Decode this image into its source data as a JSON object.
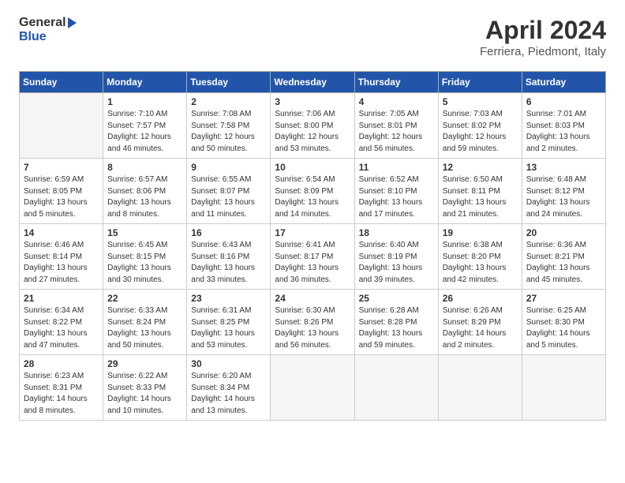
{
  "logo": {
    "general": "General",
    "blue": "Blue"
  },
  "title": "April 2024",
  "subtitle": "Ferriera, Piedmont, Italy",
  "days_of_week": [
    "Sunday",
    "Monday",
    "Tuesday",
    "Wednesday",
    "Thursday",
    "Friday",
    "Saturday"
  ],
  "weeks": [
    [
      {
        "day": "",
        "content": "",
        "empty": true
      },
      {
        "day": "1",
        "content": "Sunrise: 7:10 AM\nSunset: 7:57 PM\nDaylight: 12 hours\nand 46 minutes."
      },
      {
        "day": "2",
        "content": "Sunrise: 7:08 AM\nSunset: 7:58 PM\nDaylight: 12 hours\nand 50 minutes."
      },
      {
        "day": "3",
        "content": "Sunrise: 7:06 AM\nSunset: 8:00 PM\nDaylight: 12 hours\nand 53 minutes."
      },
      {
        "day": "4",
        "content": "Sunrise: 7:05 AM\nSunset: 8:01 PM\nDaylight: 12 hours\nand 56 minutes."
      },
      {
        "day": "5",
        "content": "Sunrise: 7:03 AM\nSunset: 8:02 PM\nDaylight: 12 hours\nand 59 minutes."
      },
      {
        "day": "6",
        "content": "Sunrise: 7:01 AM\nSunset: 8:03 PM\nDaylight: 13 hours\nand 2 minutes."
      }
    ],
    [
      {
        "day": "7",
        "content": "Sunrise: 6:59 AM\nSunset: 8:05 PM\nDaylight: 13 hours\nand 5 minutes."
      },
      {
        "day": "8",
        "content": "Sunrise: 6:57 AM\nSunset: 8:06 PM\nDaylight: 13 hours\nand 8 minutes."
      },
      {
        "day": "9",
        "content": "Sunrise: 6:55 AM\nSunset: 8:07 PM\nDaylight: 13 hours\nand 11 minutes."
      },
      {
        "day": "10",
        "content": "Sunrise: 6:54 AM\nSunset: 8:09 PM\nDaylight: 13 hours\nand 14 minutes."
      },
      {
        "day": "11",
        "content": "Sunrise: 6:52 AM\nSunset: 8:10 PM\nDaylight: 13 hours\nand 17 minutes."
      },
      {
        "day": "12",
        "content": "Sunrise: 6:50 AM\nSunset: 8:11 PM\nDaylight: 13 hours\nand 21 minutes."
      },
      {
        "day": "13",
        "content": "Sunrise: 6:48 AM\nSunset: 8:12 PM\nDaylight: 13 hours\nand 24 minutes."
      }
    ],
    [
      {
        "day": "14",
        "content": "Sunrise: 6:46 AM\nSunset: 8:14 PM\nDaylight: 13 hours\nand 27 minutes."
      },
      {
        "day": "15",
        "content": "Sunrise: 6:45 AM\nSunset: 8:15 PM\nDaylight: 13 hours\nand 30 minutes."
      },
      {
        "day": "16",
        "content": "Sunrise: 6:43 AM\nSunset: 8:16 PM\nDaylight: 13 hours\nand 33 minutes."
      },
      {
        "day": "17",
        "content": "Sunrise: 6:41 AM\nSunset: 8:17 PM\nDaylight: 13 hours\nand 36 minutes."
      },
      {
        "day": "18",
        "content": "Sunrise: 6:40 AM\nSunset: 8:19 PM\nDaylight: 13 hours\nand 39 minutes."
      },
      {
        "day": "19",
        "content": "Sunrise: 6:38 AM\nSunset: 8:20 PM\nDaylight: 13 hours\nand 42 minutes."
      },
      {
        "day": "20",
        "content": "Sunrise: 6:36 AM\nSunset: 8:21 PM\nDaylight: 13 hours\nand 45 minutes."
      }
    ],
    [
      {
        "day": "21",
        "content": "Sunrise: 6:34 AM\nSunset: 8:22 PM\nDaylight: 13 hours\nand 47 minutes."
      },
      {
        "day": "22",
        "content": "Sunrise: 6:33 AM\nSunset: 8:24 PM\nDaylight: 13 hours\nand 50 minutes."
      },
      {
        "day": "23",
        "content": "Sunrise: 6:31 AM\nSunset: 8:25 PM\nDaylight: 13 hours\nand 53 minutes."
      },
      {
        "day": "24",
        "content": "Sunrise: 6:30 AM\nSunset: 8:26 PM\nDaylight: 13 hours\nand 56 minutes."
      },
      {
        "day": "25",
        "content": "Sunrise: 6:28 AM\nSunset: 8:28 PM\nDaylight: 13 hours\nand 59 minutes."
      },
      {
        "day": "26",
        "content": "Sunrise: 6:26 AM\nSunset: 8:29 PM\nDaylight: 14 hours\nand 2 minutes."
      },
      {
        "day": "27",
        "content": "Sunrise: 6:25 AM\nSunset: 8:30 PM\nDaylight: 14 hours\nand 5 minutes."
      }
    ],
    [
      {
        "day": "28",
        "content": "Sunrise: 6:23 AM\nSunset: 8:31 PM\nDaylight: 14 hours\nand 8 minutes."
      },
      {
        "day": "29",
        "content": "Sunrise: 6:22 AM\nSunset: 8:33 PM\nDaylight: 14 hours\nand 10 minutes."
      },
      {
        "day": "30",
        "content": "Sunrise: 6:20 AM\nSunset: 8:34 PM\nDaylight: 14 hours\nand 13 minutes."
      },
      {
        "day": "",
        "content": "",
        "empty": true
      },
      {
        "day": "",
        "content": "",
        "empty": true
      },
      {
        "day": "",
        "content": "",
        "empty": true
      },
      {
        "day": "",
        "content": "",
        "empty": true
      }
    ]
  ]
}
